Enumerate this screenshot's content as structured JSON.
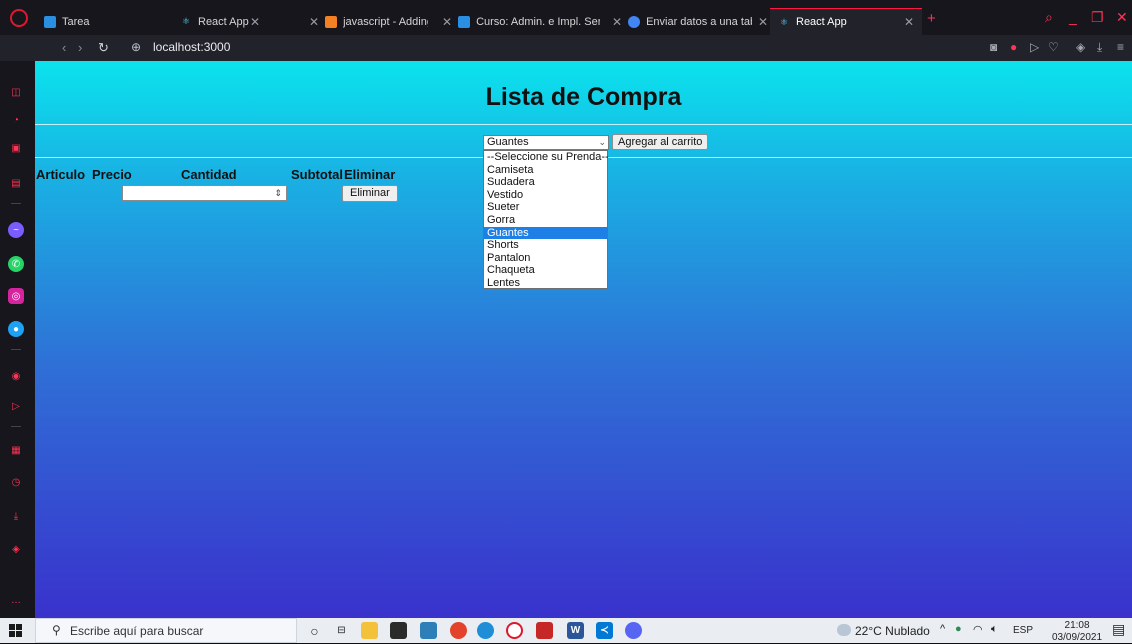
{
  "browser": {
    "tabs": [
      {
        "title": "Tarea",
        "favicon_color": "#2a8fe0",
        "active": false
      },
      {
        "title": "React App",
        "favicon_color": "#61dafb",
        "active": false
      },
      {
        "title": "javascript - Adding a Table",
        "favicon_color": "#f48024",
        "active": false
      },
      {
        "title": "Curso: Admin. e Impl. Serv.",
        "favicon_color": "#2a8fe0",
        "active": false
      },
      {
        "title": "Enviar datos a una tabla re",
        "favicon_color": "#4285f4",
        "active": false
      },
      {
        "title": "React App",
        "favicon_color": "#61dafb",
        "active": true
      }
    ],
    "url": "localhost:3000"
  },
  "app": {
    "title": "Lista de Compra",
    "select": {
      "selected": "Guantes",
      "options": [
        "--Seleccione su Prenda--",
        "Camiseta",
        "Sudadera",
        "Vestido",
        "Sueter",
        "Gorra",
        "Guantes",
        "Shorts",
        "Pantalon",
        "Chaqueta",
        "Lentes"
      ]
    },
    "add_button": "Agregar al carrito",
    "table": {
      "headers": {
        "articulo": "Articulo",
        "precio": "Precio",
        "cantidad": "Cantidad",
        "subtotal": "Subtotal",
        "eliminar": "Eliminar"
      },
      "delete_button": "Eliminar"
    }
  },
  "taskbar": {
    "search_placeholder": "Escribe aquí para buscar",
    "weather": "22°C Nublado",
    "language": "ESP",
    "time": "21:08",
    "date": "03/09/2021"
  }
}
